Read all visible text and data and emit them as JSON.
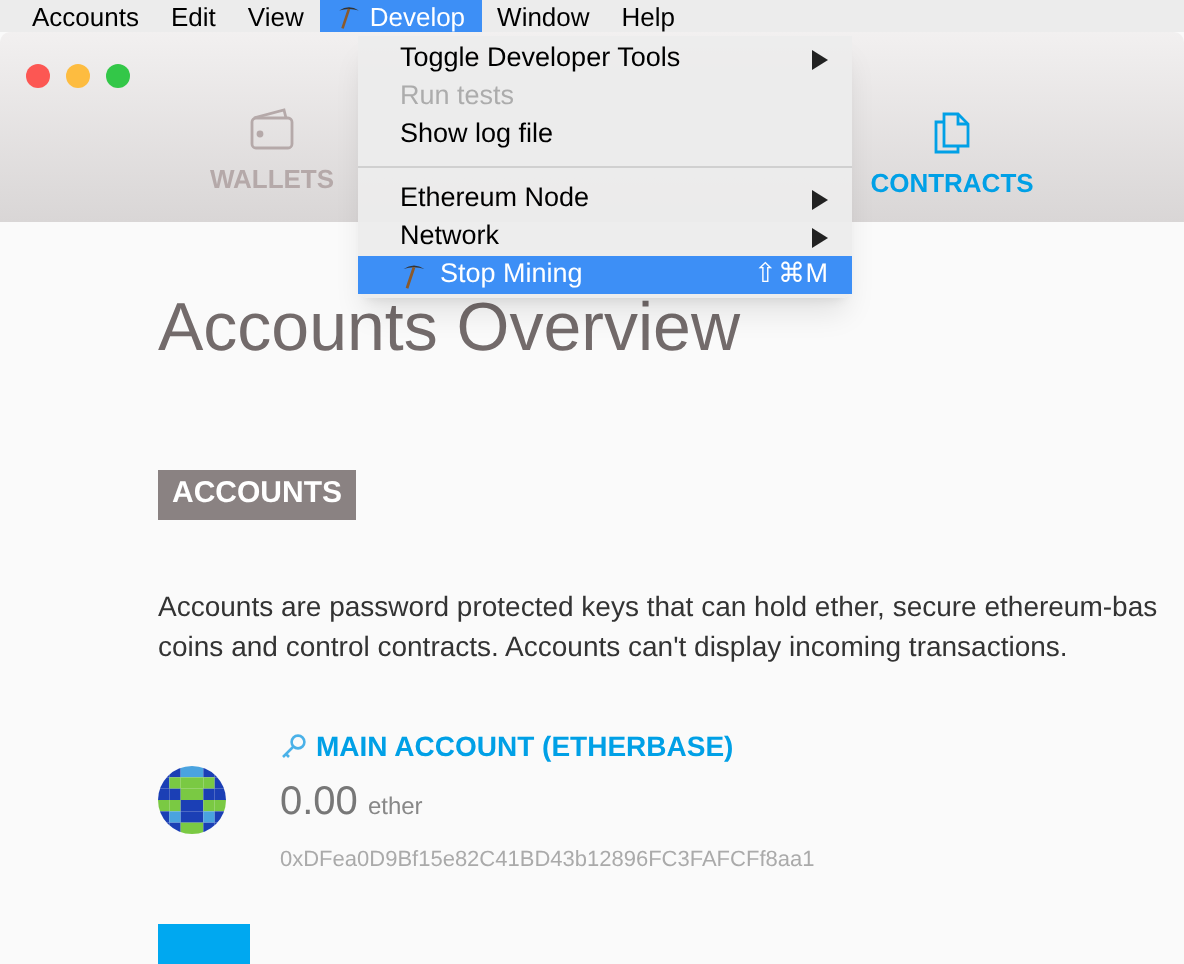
{
  "menu_bar": [
    {
      "label": "Accounts",
      "selected": false
    },
    {
      "label": "Edit",
      "selected": false
    },
    {
      "label": "View",
      "selected": false
    },
    {
      "label": "Develop",
      "selected": true,
      "kind": "mining"
    },
    {
      "label": "Window",
      "selected": false
    },
    {
      "label": "Help",
      "selected": false
    }
  ],
  "menu": {
    "items": [
      {
        "kind": "item",
        "label": "Toggle Developer Tools",
        "disabled": false,
        "submenu": true,
        "selected": false
      },
      {
        "kind": "item",
        "label": "Run tests",
        "disabled": true,
        "submenu": false,
        "selected": false
      },
      {
        "kind": "item",
        "label": "Show log file",
        "disabled": false,
        "submenu": false,
        "selected": false
      },
      {
        "kind": "separator"
      },
      {
        "kind": "item",
        "label": "Ethereum Node",
        "disabled": false,
        "submenu": true,
        "selected": false
      },
      {
        "kind": "item",
        "label": "Network",
        "disabled": false,
        "submenu": true,
        "selected": false
      },
      {
        "kind": "mining",
        "label": "Stop Mining",
        "shortcut": "⇧⌘M",
        "disabled": false,
        "submenu": false,
        "selected": true
      }
    ]
  },
  "nav_tabs": [
    {
      "label": "WALLETS",
      "kind": "wallet",
      "selected": false
    },
    {
      "label": "CONTRACTS",
      "kind": "contract",
      "selected": true
    }
  ],
  "heading": "**Accounts** Overview",
  "section_label": "ACCOUNTS",
  "description": [
    "Accounts are password protected keys that can hold ether, secure ethereum-bas",
    "coins and control contracts. Accounts can't display incoming transactions."
  ],
  "account": {
    "name": "MAIN ACCOUNT (ETHERBASE)",
    "balance": "0.00",
    "unit": "ether",
    "address": "0xDFea0D9Bf15e82C41BD43b12896FC3FAFCFf8aa1"
  }
}
